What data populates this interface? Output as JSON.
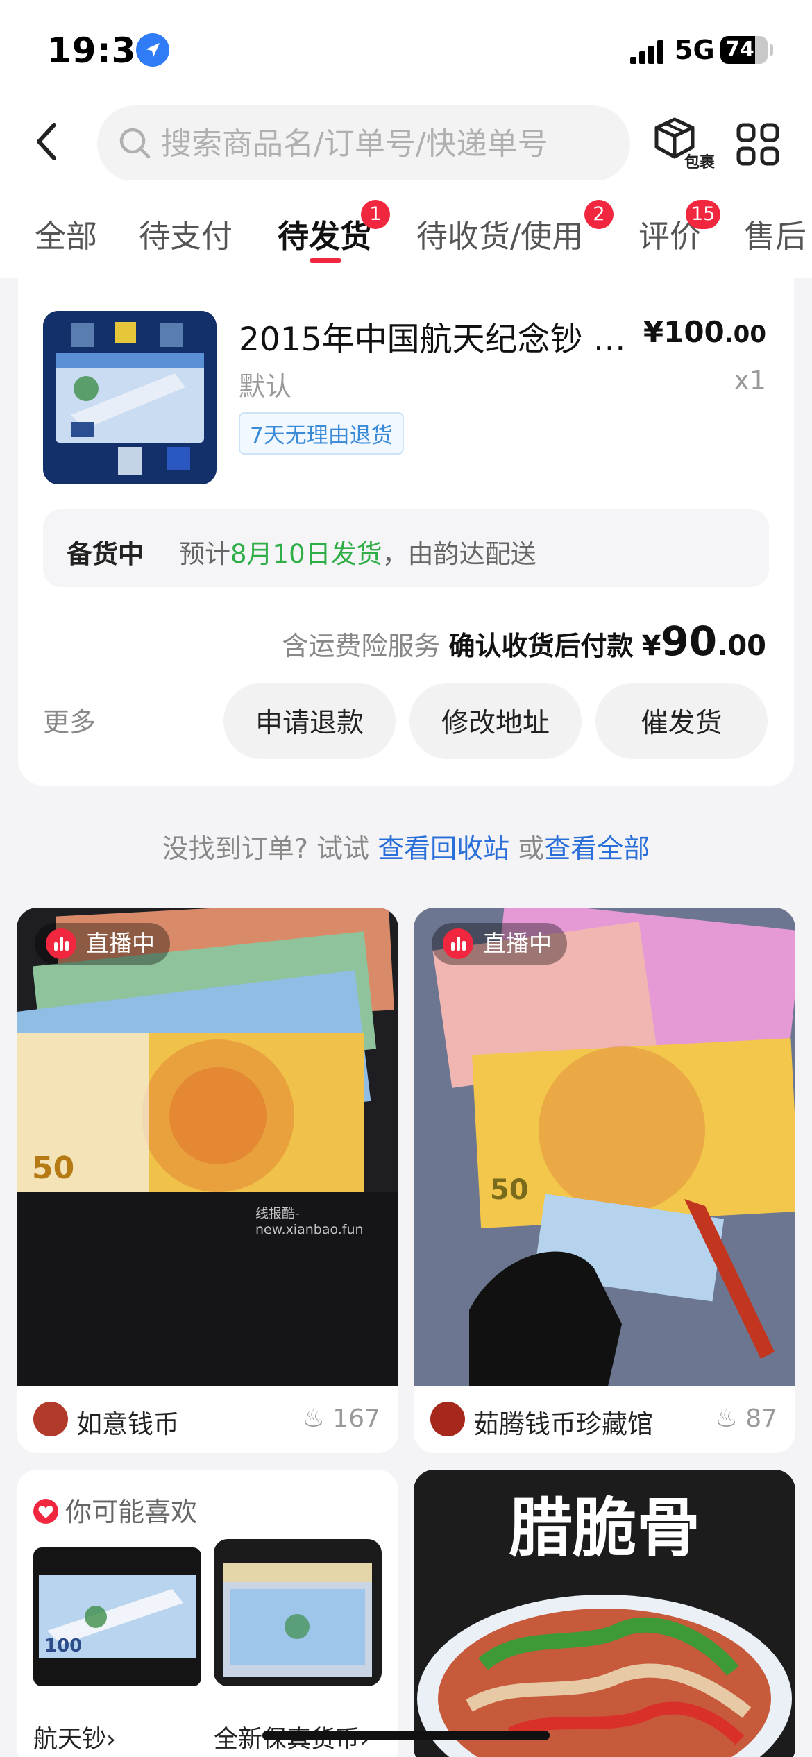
{
  "status_bar": {
    "time": "19:31",
    "network": "5G",
    "battery": "74",
    "battery_level": 0.74
  },
  "search": {
    "placeholder": "搜索商品名/订单号/快递单号",
    "package_label": "包裹"
  },
  "tabs": [
    {
      "label": "全部"
    },
    {
      "label": "待支付"
    },
    {
      "label": "待发货",
      "badge": "1",
      "active": true
    },
    {
      "label": "待收货/使用",
      "badge": "2"
    },
    {
      "label": "评价",
      "badge": "15"
    },
    {
      "label": "售后"
    }
  ],
  "order": {
    "title": "2015年中国航天纪念钞 单…",
    "price_currency": "¥",
    "price_int": "100",
    "price_dec": ".00",
    "spec": "默认",
    "quantity": "x1",
    "tag": "7天无理由退货",
    "ship_status": "备货中",
    "ship_prefix": "预计",
    "ship_date": "8月10日发货",
    "ship_suffix": "，由韵达配送",
    "pay_service": "含运费险服务",
    "pay_label": "确认收货后付款",
    "pay_currency": "¥",
    "pay_int": "90",
    "pay_dec": ".00",
    "more": "更多",
    "buttons": [
      "申请退款",
      "修改地址",
      "催发货"
    ]
  },
  "not_found": {
    "text": "没找到订单? 试试",
    "link1": "查看回收站",
    "mid": "或",
    "link2": "查看全部"
  },
  "feed": {
    "live_label": "直播中",
    "watermark": "线报酷-new.xianbao.fun",
    "items": [
      {
        "shop": "如意钱币",
        "heat": "167"
      },
      {
        "shop": "茹腾钱币珍藏馆",
        "heat": "87"
      }
    ],
    "recommend": {
      "title": "你可能喜欢",
      "items": [
        {
          "label": "航天钞"
        },
        {
          "label": "全新保真货币"
        }
      ]
    },
    "food_title": "腊脆骨"
  },
  "colors": {
    "accent": "#f0273f",
    "link": "#2a6fd9",
    "green": "#2fae47"
  }
}
